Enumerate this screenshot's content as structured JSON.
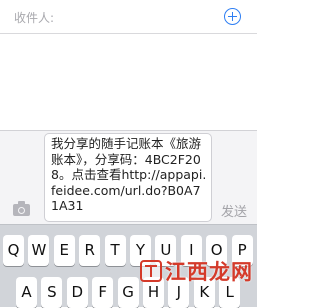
{
  "header": {
    "to_label": "收件人:",
    "add_icon": "plus-circle-icon"
  },
  "compose": {
    "message": "我分享的随手记账本《旅游账本》，分享码：4BC2F208。点击查看http://appapi.feidee.com/url.do?B0A71A31",
    "send_label": "发送",
    "camera_icon": "camera-icon"
  },
  "keyboard": {
    "row1": [
      "Q",
      "W",
      "E",
      "R",
      "T",
      "Y",
      "U",
      "I",
      "O",
      "P"
    ],
    "row2": [
      "A",
      "S",
      "D",
      "F",
      "G",
      "H",
      "J",
      "K",
      "L"
    ]
  },
  "watermark": {
    "text": "江西龙网"
  },
  "colors": {
    "accent": "#2f7ff3",
    "watermark": "#d43a2a",
    "keyboard_bg": "#d1d4d9"
  }
}
